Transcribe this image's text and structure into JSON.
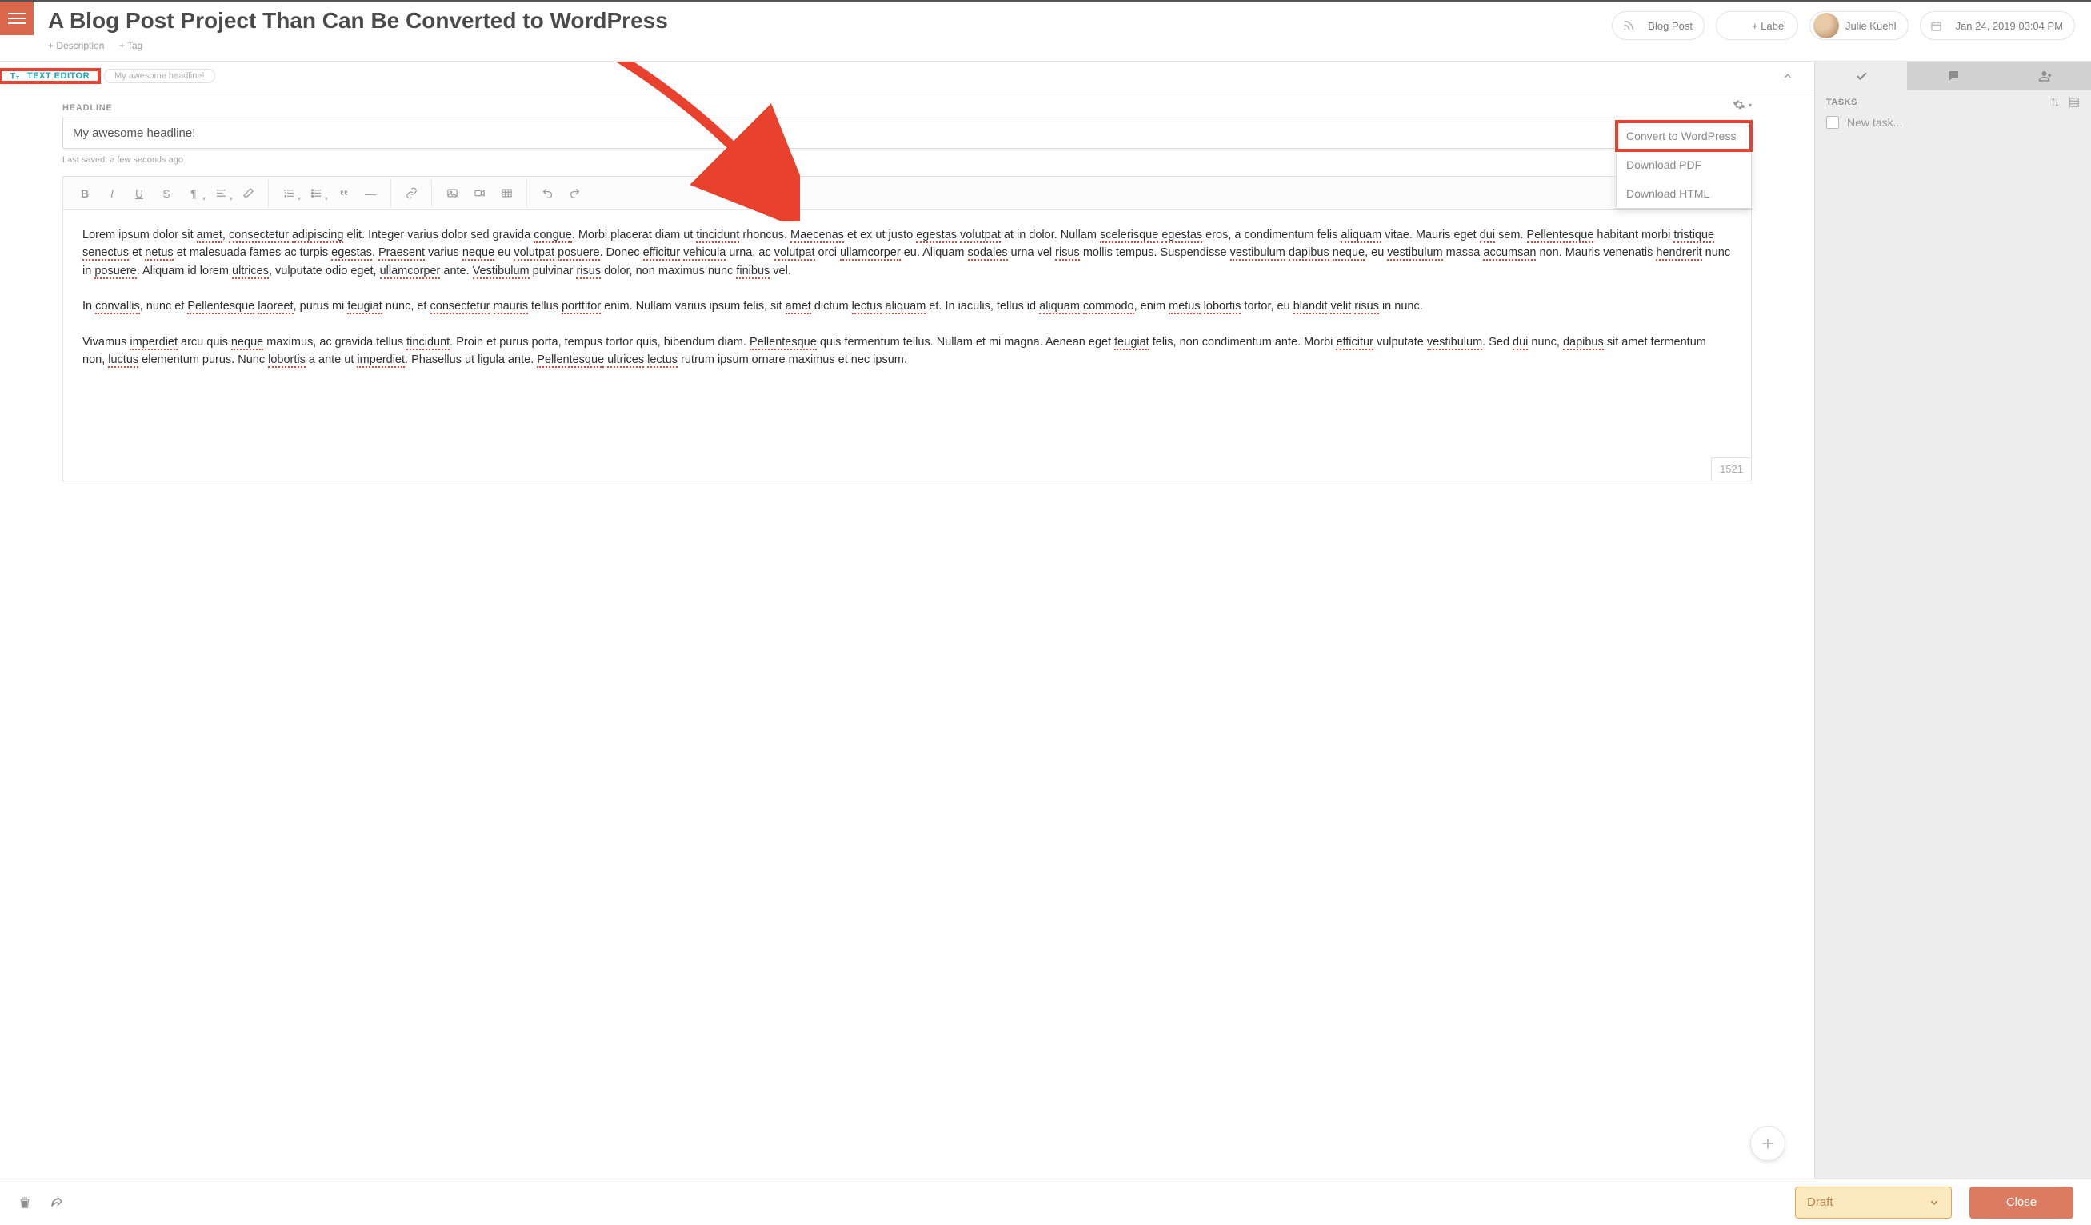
{
  "header": {
    "title": "A Blog Post Project Than Can Be Converted to WordPress",
    "add_description": "+ Description",
    "add_tag": "+ Tag",
    "type_label": "Blog Post",
    "add_label": "+ Label",
    "user_name": "Julie Kuehl",
    "date_time": "Jan 24, 2019 03:04 PM"
  },
  "tabrow": {
    "text_editor": "TEXT EDITOR",
    "headline_chip": "My awesome headline!"
  },
  "editor": {
    "headline_label": "HEADLINE",
    "headline_value": "My awesome headline!",
    "last_saved": "Last saved: a few seconds ago",
    "word_count": "1521"
  },
  "dropdown": {
    "convert": "Convert to WordPress",
    "pdf": "Download PDF",
    "html": "Download HTML"
  },
  "content": {
    "p1a": "Lorem ipsum dolor sit ",
    "p1b": ", ",
    "p1c": " ",
    "p1d": " elit. Integer varius dolor sed gravida ",
    "p1e": ". Morbi placerat diam ut ",
    "p1f": " rhoncus. ",
    "sp_amet": "amet",
    "sp_consectetur": "consectetur",
    "sp_adipiscing": "adipiscing",
    "sp_congue": "congue",
    "sp_tincidunt": "tincidunt",
    "p1g": "Maecenas",
    "p1h": " et ex ut justo ",
    "sp_egestas": "egestas",
    "sp_volutpat": "volutpat",
    "p1i": " at in dolor. Nullam ",
    "sp_scelerisque": "scelerisque",
    "p1j": " eros, a condimentum felis ",
    "sp_aliquam": "aliquam",
    "p1k": " vitae. Mauris eget ",
    "sp_dui": "dui",
    "p1l": " sem. ",
    "sp_pellentesque": "Pellentesque",
    "p1m": " habitant morbi ",
    "sp_tristique": "tristique",
    "sp_senectus": "senectus",
    "p1n": " et ",
    "sp_netus": "netus",
    "p1o": " et malesuada fames ac turpis ",
    "p1p": ". ",
    "sp_praesent": "Praesent",
    "p1q": " varius ",
    "sp_neque": "neque",
    "p1r": " eu ",
    "sp_posuere": "posuere",
    "p1s": ". Donec ",
    "sp_efficitur": "efficitur",
    "sp_vehicula": "vehicula",
    "p1t": " urna, ac ",
    "p1u": " orci ",
    "sp_ullamcorper": "ullamcorper",
    "p1v": " eu. Aliquam ",
    "sp_sodales": "sodales",
    "p1w": " urna vel ",
    "sp_risus": "risus",
    "p1x": " mollis tempus. Suspendisse ",
    "sp_vestibulum": "vestibulum",
    "sp_dapibus": "dapibus",
    "p1y": ", eu ",
    "p1z": " massa ",
    "sp_accumsan": "accumsan",
    "p1za": " non. Mauris venenatis ",
    "sp_hendrerit": "hendrerit",
    "p1zb": " nunc in ",
    "p1zc": ". Aliquam id lorem ",
    "sp_ultrices": "ultrices",
    "p1zd": ", vulputate odio eget, ",
    "p1ze": " ante. ",
    "sp_vestibulum_cap": "Vestibulum",
    "p1zf": " pulvinar ",
    "p1zg": " dolor, non maximus nunc ",
    "sp_finibus": "finibus",
    "p1zh": " vel.",
    "p2a": "In ",
    "sp_convallis": "convallis",
    "p2b": ", nunc et ",
    "sp_laoreet": "laoreet",
    "p2c": ", purus mi ",
    "sp_feugiat": "feugiat",
    "p2d": " nunc, et ",
    "p2e": " ",
    "sp_mauris": "mauris",
    "p2f": " tellus ",
    "sp_porttitor": "porttitor",
    "p2g": " enim. Nullam varius ipsum felis, sit ",
    "p2h": " dictum ",
    "sp_lectus": "lectus",
    "p2i": " et. In iaculis, tellus id ",
    "sp_commodo": "commodo",
    "p2j": ", enim ",
    "sp_metus": "metus",
    "sp_lobortis": "lobortis",
    "p2k": " tortor, eu ",
    "sp_blandit": "blandit",
    "sp_velit": "velit",
    "p2l": " in nunc.",
    "p3a": "Vivamus ",
    "sp_imperdiet": "imperdiet",
    "p3b": " arcu quis ",
    "p3c": " maximus, ac gravida tellus ",
    "p3d": ". Proin et purus porta, tempus tortor quis, bibendum diam. ",
    "p3e": " quis fermentum tellus. Nullam et mi magna. Aenean eget ",
    "p3f": " felis, non condimentum ante. Morbi ",
    "p3g": " vulputate ",
    "p3h": ". Sed ",
    "p3i": " nunc, ",
    "p3j": " sit amet fermentum non, ",
    "sp_luctus": "luctus",
    "p3k": " elementum purus. Nunc ",
    "p3l": " a ante ut ",
    "p3m": ". Phasellus ut ligula ante. ",
    "p3n": " rutrum ipsum ornare maximus et nec ipsum."
  },
  "sidebar": {
    "tasks_label": "TASKS",
    "new_task": "New task..."
  },
  "footer": {
    "draft": "Draft",
    "close": "Close"
  }
}
